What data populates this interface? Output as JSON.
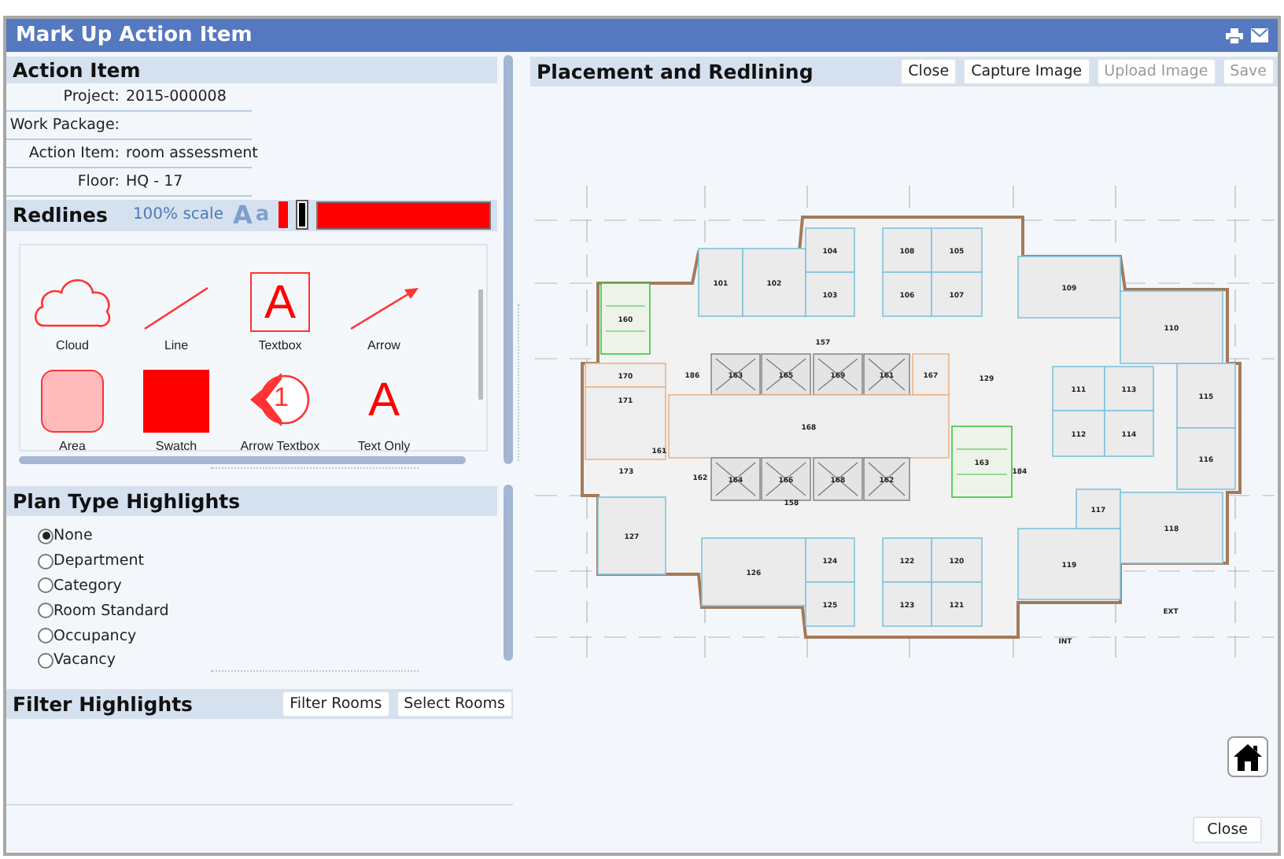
{
  "window": {
    "title": "Mark Up Action Item"
  },
  "action_item": {
    "title": "Action Item",
    "fields": [
      {
        "label": "Project:",
        "value": "2015-000008"
      },
      {
        "label": "Work Package:"
      },
      {
        "label": "Action Item:",
        "value": "room assessment"
      },
      {
        "label": "Floor:",
        "value": "HQ - 17"
      }
    ]
  },
  "redlines": {
    "title": "Redlines",
    "scale": "100% scale",
    "font_sizes": [
      "A",
      "a"
    ],
    "swatches": [
      {
        "kind": "small",
        "color": "#ff0000",
        "selected": false
      },
      {
        "kind": "small",
        "color": "#000000",
        "selected": true
      },
      {
        "kind": "bar",
        "color": "#ff0000",
        "selected": false
      }
    ],
    "tools": [
      {
        "label": "Cloud",
        "kind": "cloud"
      },
      {
        "label": "Line",
        "kind": "line"
      },
      {
        "label": "Textbox",
        "kind": "textbox",
        "glyph": "A"
      },
      {
        "label": "Arrow",
        "kind": "arrow"
      },
      {
        "label": "Area",
        "kind": "area"
      },
      {
        "label": "Swatch",
        "kind": "swatch"
      },
      {
        "label": "Arrow Textbox",
        "kind": "arrow-textbox",
        "glyph": "1"
      },
      {
        "label": "Text Only",
        "kind": "text",
        "glyph": "A"
      }
    ]
  },
  "plan_type": {
    "title": "Plan Type Highlights",
    "options": [
      {
        "label": "None",
        "selected": true
      },
      {
        "label": "Department",
        "selected": false
      },
      {
        "label": "Category",
        "selected": false
      },
      {
        "label": "Room Standard",
        "selected": false
      },
      {
        "label": "Occupancy",
        "selected": false
      },
      {
        "label": "Vacancy",
        "selected": false
      }
    ]
  },
  "filter": {
    "title": "Filter Highlights",
    "buttons": [
      "Filter Rooms",
      "Select Rooms"
    ]
  },
  "placement": {
    "title": "Placement and Redlining",
    "buttons": [
      {
        "label": "Close",
        "disabled": false
      },
      {
        "label": "Capture Image",
        "disabled": false
      },
      {
        "label": "Upload Image",
        "disabled": true
      },
      {
        "label": "Save",
        "disabled": true
      }
    ],
    "rooms": [
      {
        "label": "104",
        "kind": "office"
      },
      {
        "label": "108",
        "kind": "office"
      },
      {
        "label": "105",
        "kind": "office"
      },
      {
        "label": "101",
        "kind": "office"
      },
      {
        "label": "102",
        "kind": "office"
      },
      {
        "label": "109",
        "kind": "office"
      },
      {
        "label": "103",
        "kind": "office"
      },
      {
        "label": "106",
        "kind": "office"
      },
      {
        "label": "107",
        "kind": "office"
      },
      {
        "label": "160",
        "kind": "stair"
      },
      {
        "label": "110",
        "kind": "office"
      },
      {
        "label": "157",
        "kind": "label"
      },
      {
        "label": "170",
        "kind": "core"
      },
      {
        "label": "186",
        "kind": "label"
      },
      {
        "label": "163",
        "kind": "elevator"
      },
      {
        "label": "165",
        "kind": "elevator"
      },
      {
        "label": "169",
        "kind": "elevator"
      },
      {
        "label": "161",
        "kind": "elevator"
      },
      {
        "label": "167",
        "kind": "core"
      },
      {
        "label": "129",
        "kind": "label"
      },
      {
        "label": "111",
        "kind": "office"
      },
      {
        "label": "113",
        "kind": "office"
      },
      {
        "label": "115",
        "kind": "office"
      },
      {
        "label": "171",
        "kind": "core"
      },
      {
        "label": "168",
        "kind": "core"
      },
      {
        "label": "112",
        "kind": "office"
      },
      {
        "label": "114",
        "kind": "office"
      },
      {
        "label": "161",
        "kind": "label"
      },
      {
        "label": "116",
        "kind": "office"
      },
      {
        "label": "163",
        "kind": "stair"
      },
      {
        "label": "173",
        "kind": "label"
      },
      {
        "label": "184",
        "kind": "label"
      },
      {
        "label": "162",
        "kind": "label"
      },
      {
        "label": "164",
        "kind": "elevator"
      },
      {
        "label": "166",
        "kind": "elevator"
      },
      {
        "label": "168",
        "kind": "elevator"
      },
      {
        "label": "162",
        "kind": "elevator"
      },
      {
        "label": "158",
        "kind": "label"
      },
      {
        "label": "117",
        "kind": "office"
      },
      {
        "label": "118",
        "kind": "office"
      },
      {
        "label": "127",
        "kind": "office"
      },
      {
        "label": "124",
        "kind": "office"
      },
      {
        "label": "122",
        "kind": "office"
      },
      {
        "label": "120",
        "kind": "office"
      },
      {
        "label": "119",
        "kind": "office"
      },
      {
        "label": "126",
        "kind": "office"
      },
      {
        "label": "125",
        "kind": "office"
      },
      {
        "label": "123",
        "kind": "office"
      },
      {
        "label": "121",
        "kind": "office"
      },
      {
        "label": "EXT",
        "kind": "label"
      },
      {
        "label": "INT",
        "kind": "label"
      }
    ]
  },
  "footer": {
    "button": "Close"
  }
}
